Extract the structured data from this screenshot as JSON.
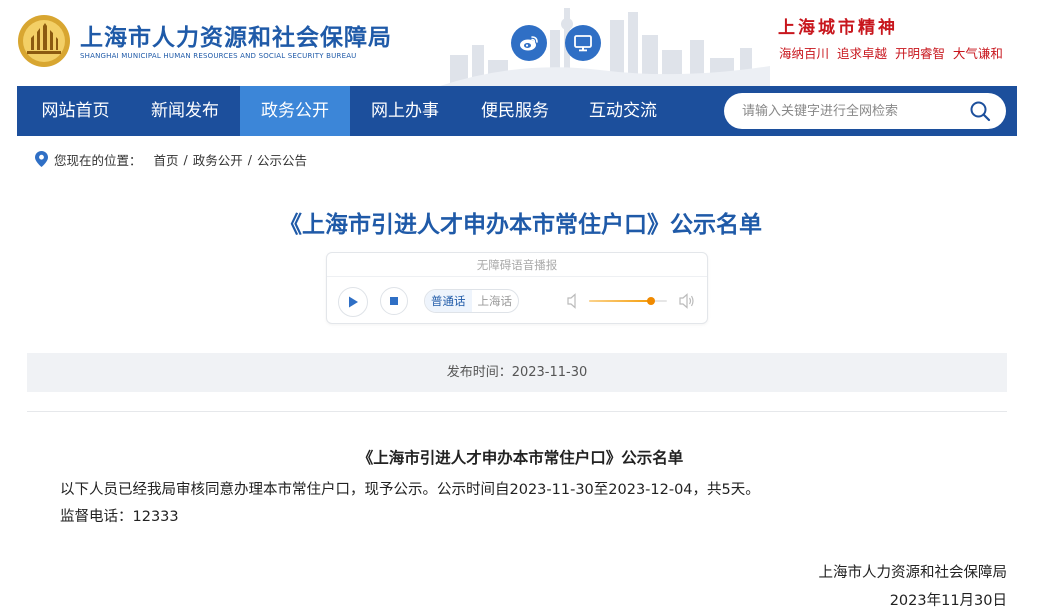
{
  "header": {
    "site_title": "上海市人力资源和社会保障局",
    "site_subtitle": "SHANGHAI MUNICIPAL HUMAN RESOURCES AND SOCIAL SECURITY BUREAU",
    "logo_icon": "shanghai-emblem-logo",
    "weibo_icon": "weibo-icon",
    "screen_icon": "monitor-icon",
    "spirit_title": "上海城市精神",
    "spirit_text": "海纳百川 追求卓越 开明睿智 大气谦和",
    "brand_color": "#1f5aa8",
    "accent_red": "#c8161d"
  },
  "nav": {
    "items": [
      {
        "label": "网站首页",
        "active": false
      },
      {
        "label": "新闻发布",
        "active": false
      },
      {
        "label": "政务公开",
        "active": true
      },
      {
        "label": "网上办事",
        "active": false
      },
      {
        "label": "便民服务",
        "active": false
      },
      {
        "label": "互动交流",
        "active": false
      }
    ],
    "background": "#1c4f9c",
    "active_background": "#3c86d8",
    "search": {
      "placeholder": "请输入关键字进行全网检索",
      "value": "",
      "icon": "search-icon"
    }
  },
  "breadcrumb": {
    "label": "您现在的位置：",
    "items": [
      "首页",
      "政务公开",
      "公示公告"
    ],
    "separator": "/",
    "icon": "location-pin-icon"
  },
  "article": {
    "title": "《上海市引进人才申办本市常住户口》公示名单",
    "publish_time": "发布时间：2023-11-30"
  },
  "player": {
    "title": "无障碍语音播报",
    "play_icon": "play-icon",
    "stop_icon": "stop-icon",
    "languages": [
      "普通话",
      "上海话"
    ],
    "selected_language": "普通话",
    "volume": 0.8,
    "volume_low_icon": "volume-low-icon",
    "volume_high_icon": "volume-high-icon"
  },
  "content": {
    "title": "《上海市引进人才申办本市常住户口》公示名单",
    "paragraphs": [
      "以下人员已经我局审核同意办理本市常住户口，现予公示。公示时间自2023-11-30至2023-12-04，共5天。",
      "监督电话：12333"
    ],
    "signature_org": "上海市人力资源和社会保障局",
    "signature_date": "2023年11月30日"
  }
}
